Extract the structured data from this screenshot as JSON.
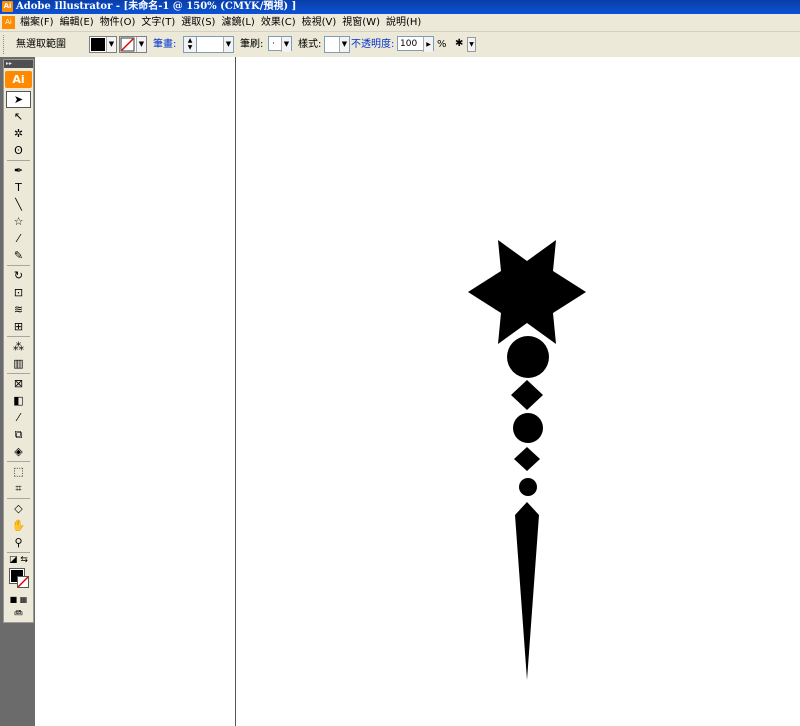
{
  "window": {
    "title": "Adobe Illustrator - [未命名-1 @ 150% (CMYK/預視) ]",
    "app_icon_text": "Ai"
  },
  "menubar": {
    "doc_icon_text": "Ai",
    "items": [
      "檔案(F)",
      "編輯(E)",
      "物件(O)",
      "文字(T)",
      "選取(S)",
      "濾鏡(L)",
      "效果(C)",
      "檢視(V)",
      "視窗(W)",
      "說明(H)"
    ]
  },
  "controlbar": {
    "selection_status": "無選取範圍",
    "fill_color": "#000000",
    "stroke_label": "筆畫:",
    "brush_label": "筆刷:",
    "brush_value": "·",
    "style_label": "樣式:",
    "opacity_label": "不透明度:",
    "opacity_value": "100",
    "opacity_unit": "%"
  },
  "toolbox": {
    "logo": "Ai",
    "tools": [
      {
        "name": "selection-tool",
        "glyph": "➤",
        "selected": true
      },
      {
        "name": "direct-selection-tool",
        "glyph": "↖"
      },
      {
        "name": "magic-wand-tool",
        "glyph": "✲"
      },
      {
        "name": "lasso-tool",
        "glyph": "ʘ"
      },
      {
        "name": "pen-tool",
        "glyph": "✒"
      },
      {
        "name": "type-tool",
        "glyph": "T"
      },
      {
        "name": "line-tool",
        "glyph": "╲"
      },
      {
        "name": "star-tool",
        "glyph": "☆"
      },
      {
        "name": "paintbrush-tool",
        "glyph": "⁄"
      },
      {
        "name": "pencil-tool",
        "glyph": "✎"
      },
      {
        "name": "rotate-tool",
        "glyph": "↻"
      },
      {
        "name": "scale-tool",
        "glyph": "⊡"
      },
      {
        "name": "warp-tool",
        "glyph": "≋"
      },
      {
        "name": "free-transform-tool",
        "glyph": "⊞"
      },
      {
        "name": "symbol-sprayer-tool",
        "glyph": "⁂"
      },
      {
        "name": "column-graph-tool",
        "glyph": "▥"
      },
      {
        "name": "mesh-tool",
        "glyph": "⊠"
      },
      {
        "name": "gradient-tool",
        "glyph": "◧"
      },
      {
        "name": "eyedropper-tool",
        "glyph": "⁄"
      },
      {
        "name": "blend-tool",
        "glyph": "⧉"
      },
      {
        "name": "live-paint-bucket-tool",
        "glyph": "◈"
      },
      {
        "name": "live-paint-selection-tool",
        "glyph": "⬚"
      },
      {
        "name": "slice-tool",
        "glyph": "⌗"
      },
      {
        "name": "eraser-tool",
        "glyph": "◇"
      },
      {
        "name": "hand-tool",
        "glyph": "✋"
      },
      {
        "name": "zoom-tool",
        "glyph": "⚲"
      }
    ]
  }
}
